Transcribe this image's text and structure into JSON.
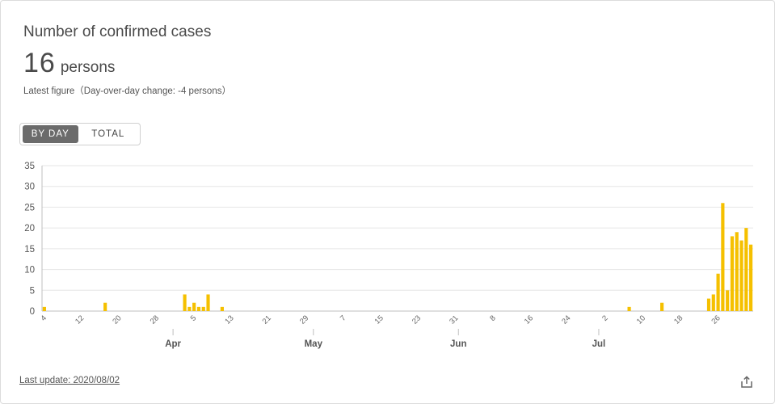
{
  "title": "Number of confirmed cases",
  "figure": {
    "value": "16",
    "unit": "persons"
  },
  "subtitle": "Latest figure（Day-over-day change: -4 persons）",
  "toggle": {
    "by_day": "BY DAY",
    "total": "TOTAL",
    "selected": "by_day"
  },
  "footer": {
    "last_update": "Last update: 2020/08/02"
  },
  "icons": {
    "share": "share-icon"
  },
  "colors": {
    "bar": "#f5c000",
    "grid": "#e6e6e6",
    "axis": "#bfbfbf"
  },
  "chart_data": {
    "type": "bar",
    "title": "",
    "xlabel": "",
    "ylabel": "",
    "ylim": [
      0,
      35
    ],
    "yticks": [
      0,
      5,
      10,
      15,
      20,
      25,
      30,
      35
    ],
    "grid": true,
    "x_range": [
      "2020-03-04",
      "2020-08-02"
    ],
    "x_tick_labels": [
      "4",
      "12",
      "20",
      "28",
      "5",
      "13",
      "21",
      "29",
      "7",
      "15",
      "23",
      "31",
      "8",
      "16",
      "24",
      "2",
      "10",
      "18",
      "26"
    ],
    "month_labels": [
      "Apr",
      "May",
      "Jun",
      "Jul"
    ],
    "series": [
      {
        "points": [
          [
            "2020-03-04",
            1
          ],
          [
            "2020-03-17",
            2
          ],
          [
            "2020-04-03",
            4
          ],
          [
            "2020-04-04",
            1
          ],
          [
            "2020-04-05",
            2
          ],
          [
            "2020-04-06",
            1
          ],
          [
            "2020-04-07",
            1
          ],
          [
            "2020-04-08",
            4
          ],
          [
            "2020-04-11",
            1
          ],
          [
            "2020-07-07",
            1
          ],
          [
            "2020-07-14",
            2
          ],
          [
            "2020-07-24",
            3
          ],
          [
            "2020-07-25",
            4
          ],
          [
            "2020-07-26",
            9
          ],
          [
            "2020-07-27",
            26
          ],
          [
            "2020-07-28",
            5
          ],
          [
            "2020-07-29",
            18
          ],
          [
            "2020-07-30",
            19
          ],
          [
            "2020-07-31",
            17
          ],
          [
            "2020-08-01",
            20
          ],
          [
            "2020-08-02",
            16
          ]
        ]
      }
    ]
  }
}
